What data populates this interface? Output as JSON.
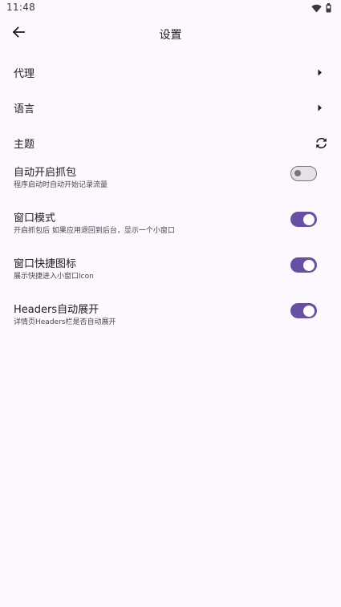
{
  "status_bar": {
    "time": "11:48",
    "icons": [
      "wifi-icon",
      "battery-icon"
    ]
  },
  "app_bar": {
    "title": "设置",
    "back_icon": "arrow-back-icon"
  },
  "settings": {
    "proxy": {
      "label": "代理",
      "icon": "arrow-right-icon"
    },
    "language": {
      "label": "语言",
      "icon": "arrow-right-icon"
    },
    "theme": {
      "label": "主题",
      "icon": "sync-icon"
    },
    "auto_capture": {
      "label": "自动开启抓包",
      "description": "程序启动时自动开始记录流量",
      "enabled": false
    },
    "window_mode": {
      "label": "窗口模式",
      "description": "开启抓包后 如果应用退回到后台，显示一个小窗口",
      "enabled": true
    },
    "window_shortcut": {
      "label": "窗口快捷图标",
      "description": "展示快捷进入小窗口Icon",
      "enabled": true
    },
    "headers_expand": {
      "label": "Headers自动展开",
      "description": "详情页Headers栏是否自动展开",
      "enabled": true
    }
  },
  "colors": {
    "background": "#fdf7ff",
    "accent": "#6750a4",
    "switch_off_track": "#e8e0e8",
    "switch_off_outline": "#79747e"
  }
}
